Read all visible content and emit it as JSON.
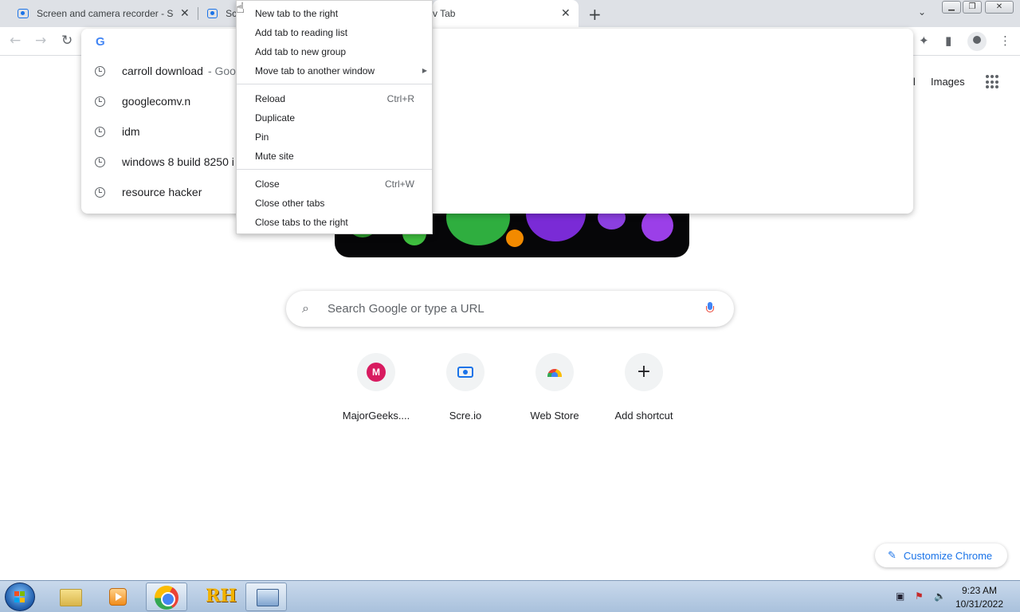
{
  "tabs": [
    {
      "title": "Screen and camera recorder - Sc"
    },
    {
      "title": "Sc"
    },
    {
      "title": "v Tab"
    }
  ],
  "omnibox": {
    "suggestions": [
      {
        "text": "carroll download",
        "suffix": "- Goo"
      },
      {
        "text": "googlecomv.n",
        "suffix": ""
      },
      {
        "text": "idm",
        "suffix": ""
      },
      {
        "text": "windows 8 build 8250 i",
        "suffix": ""
      },
      {
        "text": "resource hacker",
        "suffix": ""
      }
    ]
  },
  "context_menu": {
    "items": [
      {
        "label": "New tab to the right",
        "accel": ""
      },
      {
        "label": "Add tab to reading list",
        "accel": ""
      },
      {
        "label": "Add tab to new group",
        "accel": ""
      },
      {
        "label": "Move tab to another window",
        "accel": ""
      },
      {
        "label": "Reload",
        "accel": "Ctrl+R"
      },
      {
        "label": "Duplicate",
        "accel": ""
      },
      {
        "label": "Pin",
        "accel": ""
      },
      {
        "label": "Mute site",
        "accel": ""
      },
      {
        "label": "Close",
        "accel": "Ctrl+W"
      },
      {
        "label": "Close other tabs",
        "accel": ""
      },
      {
        "label": "Close tabs to the right",
        "accel": ""
      }
    ]
  },
  "ntp": {
    "header_links": {
      "gmail_partial": "il",
      "images": "Images"
    },
    "search_placeholder": "Search Google or type a URL",
    "shortcuts": [
      {
        "label": "MajorGeeks....",
        "letter": "M"
      },
      {
        "label": "Scre.io"
      },
      {
        "label": "Web Store"
      },
      {
        "label": "Add shortcut"
      }
    ],
    "customize_label": "Customize Chrome"
  },
  "taskbar": {
    "time": "9:23 AM",
    "date": "10/31/2022",
    "rh_label": "RH"
  },
  "colors": {
    "accent": "#1a73e8",
    "tabstrip": "#dee1e6",
    "taskbar": "#b7cbe2"
  }
}
